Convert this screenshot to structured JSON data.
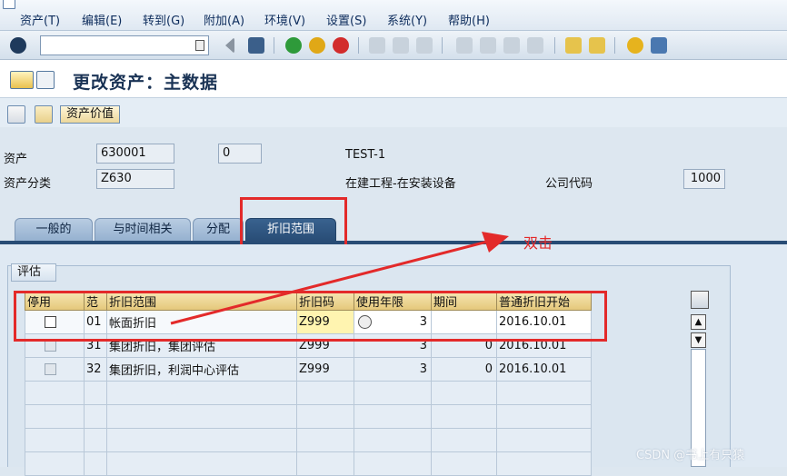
{
  "menu": [
    "资产(T)",
    "编辑(E)",
    "转到(G)",
    "附加(A)",
    "环境(V)",
    "设置(S)",
    "系统(Y)",
    "帮助(H)"
  ],
  "toolbar": {
    "command_value": ""
  },
  "header": {
    "title": "更改资产：主数据"
  },
  "app_toolbar": {
    "asset_value_button": "资产价值"
  },
  "fields": {
    "asset_label": "资产",
    "asset_number": "630001",
    "asset_sub": "0",
    "asset_desc": "TEST-1",
    "asset_class_label": "资产分类",
    "asset_class": "Z630",
    "asset_class_desc": "在建工程-在安装设备",
    "company_code_label": "公司代码",
    "company_code": "1000"
  },
  "tabs": [
    {
      "label": "一般的",
      "active": false
    },
    {
      "label": "与时间相关",
      "active": false
    },
    {
      "label": "分配",
      "active": false
    },
    {
      "label": "折旧范围",
      "active": true
    }
  ],
  "annotation": "双击",
  "group_title": "评估",
  "grid": {
    "columns": [
      "停用",
      "范",
      "折旧范围",
      "折旧码",
      "使用年限",
      "期间",
      "普通折旧开始"
    ],
    "rows": [
      {
        "area": "01",
        "name": "帐面折旧",
        "key": "Z999",
        "years": "3",
        "period": "",
        "start": "2016.10.01",
        "editable": true
      },
      {
        "area": "31",
        "name": "集团折旧，集团评估",
        "key": "Z999",
        "years": "3",
        "period": "0",
        "start": "2016.10.01",
        "editable": false
      },
      {
        "area": "32",
        "name": "集团折旧，利润中心评估",
        "key": "Z999",
        "years": "3",
        "period": "0",
        "start": "2016.10.01",
        "editable": false
      }
    ]
  },
  "watermark": "CSDN @书上有只猿",
  "colors": {
    "highlight": "#e32a2a",
    "active_tab": "#284c75",
    "grid_header": "#e4c77a"
  }
}
